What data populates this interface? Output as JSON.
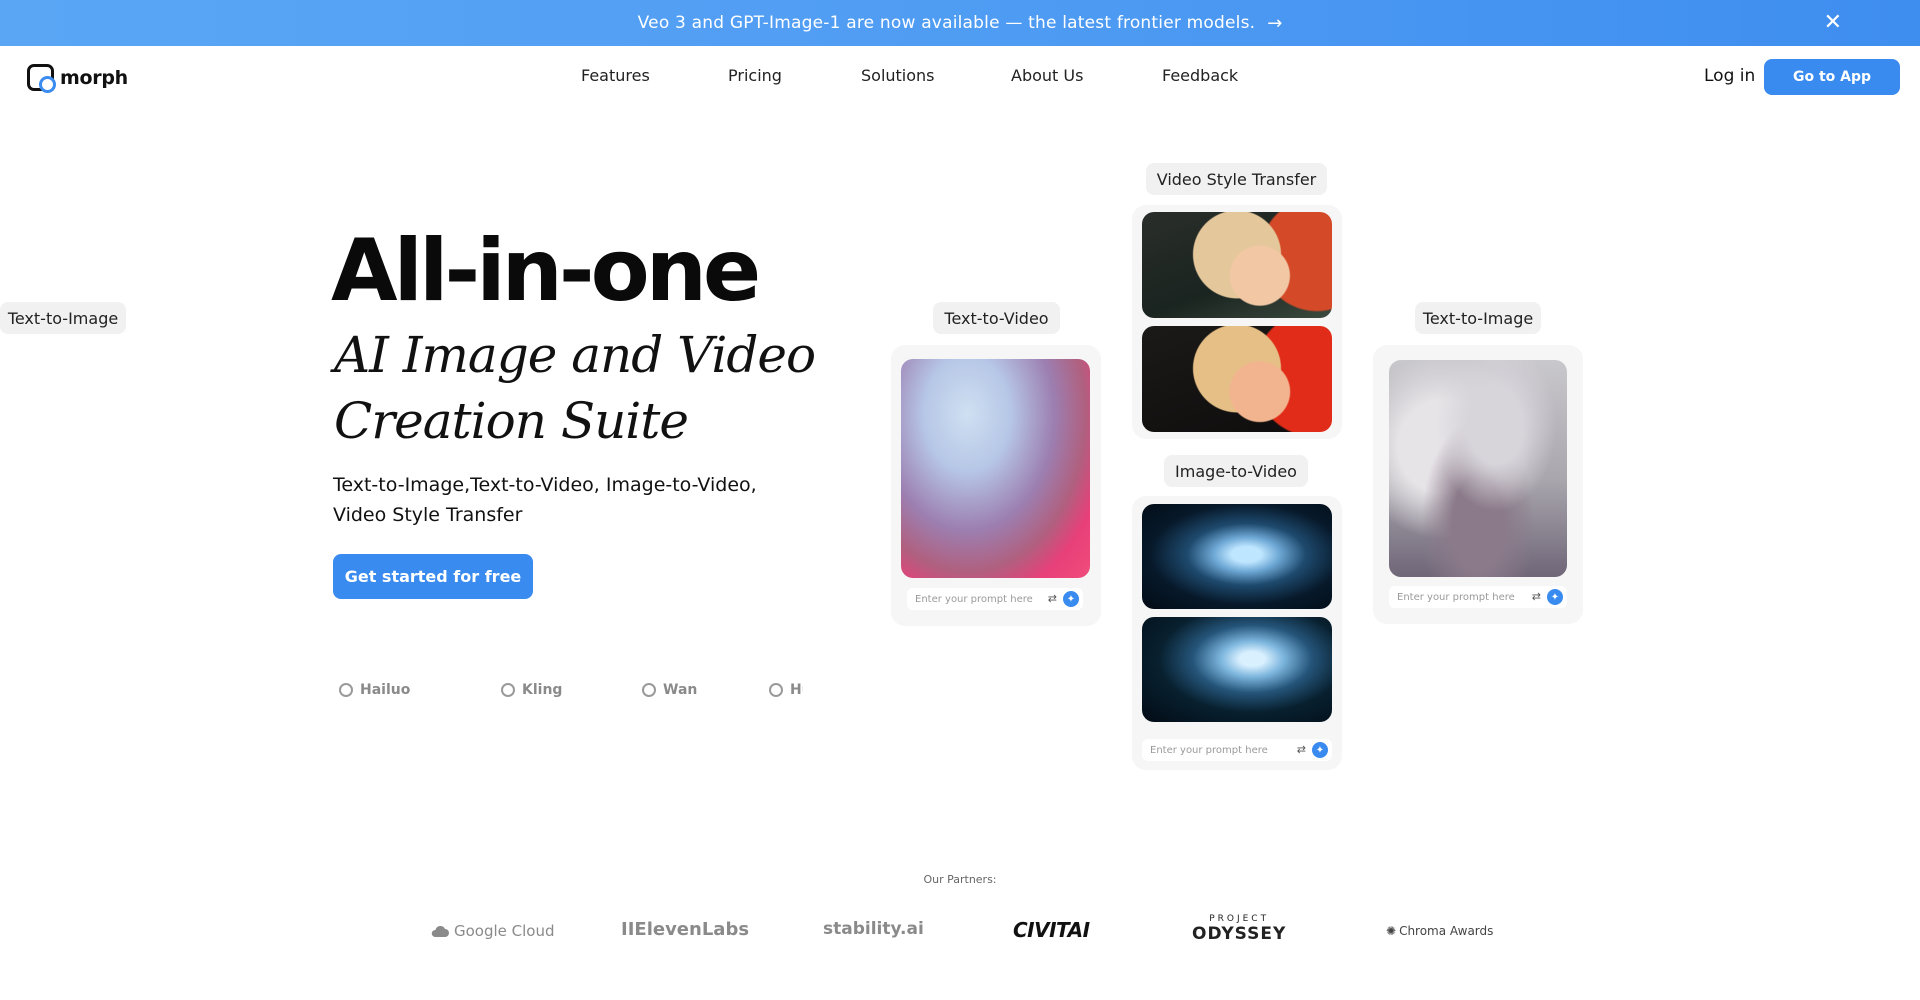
{
  "banner": {
    "text": "Veo 3 and GPT-Image-1 are now available — the latest frontier models.",
    "arrow_icon": "→",
    "close_icon": "✕"
  },
  "nav": {
    "logo_text": "morph",
    "links": [
      "Features",
      "Pricing",
      "Solutions",
      "About Us",
      "Feedback"
    ],
    "login": "Log in",
    "go_to_app": "Go to App"
  },
  "hero": {
    "title": "All-in-one",
    "script_line_1": "AI Image and Video",
    "script_line_2": "Creation Suite",
    "subtitle_line_1": "Text-to-Image,Text-to-Video, Image-to-Video,",
    "subtitle_line_2": "Video Style Transfer",
    "cta": "Get started for free",
    "models": [
      "Hailuo",
      "Kling",
      "Wan",
      "Hu"
    ]
  },
  "demos": {
    "text_to_video": {
      "label": "Text-to-Video",
      "prompt_placeholder": "Enter your prompt here"
    },
    "video_style_transfer": {
      "label": "Video Style Transfer"
    },
    "image_to_video": {
      "label": "Image-to-Video",
      "prompt_placeholder": "Enter your prompt here"
    },
    "text_to_image": {
      "label": "Text-to-Image",
      "prompt_placeholder": "Enter your prompt here"
    },
    "tune_icon": "⇄",
    "send_icon": "✦"
  },
  "partners": {
    "label": "Our Partners:",
    "names": [
      "Google Cloud",
      "IIElevenLabs",
      "stability.ai",
      "CIVITAI",
      "PROJECT",
      "ODYSSEY",
      "Chroma Awards"
    ]
  },
  "colors": {
    "accent": "#3a8bf0",
    "banner": "#4f9cf3"
  }
}
